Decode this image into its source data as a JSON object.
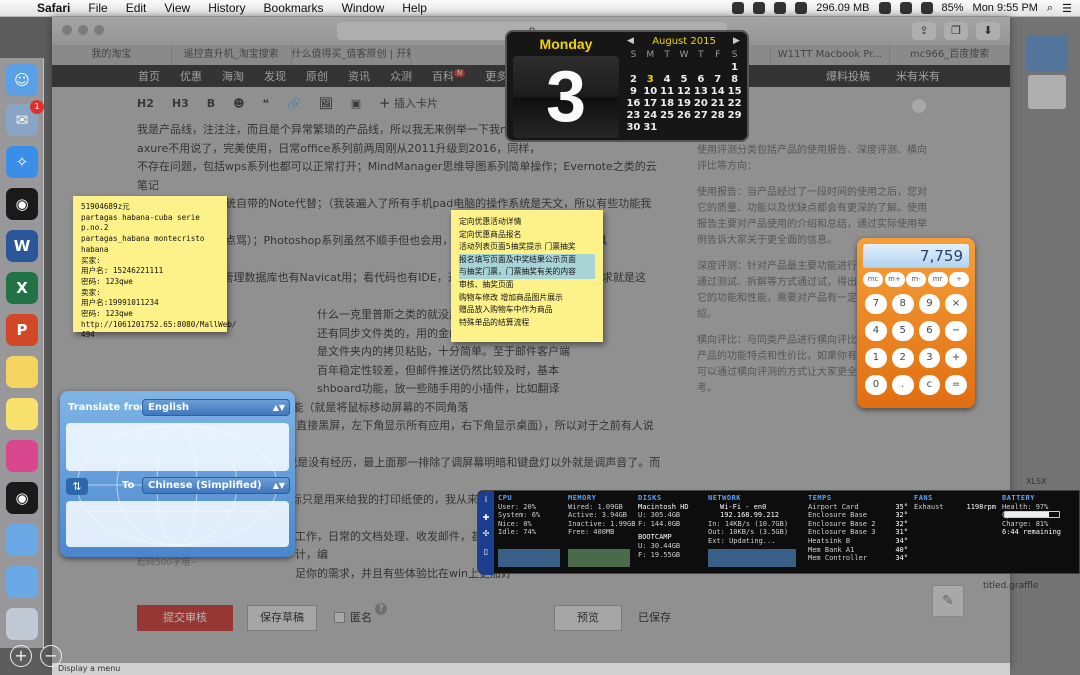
{
  "menubar": {
    "apple": "",
    "app": "Safari",
    "items": [
      "File",
      "Edit",
      "View",
      "History",
      "Bookmarks",
      "Window",
      "Help"
    ],
    "memory": "296.09 MB",
    "battery": "85%",
    "clock": "Mon 9:55 PM"
  },
  "browser": {
    "address_fragment": "p",
    "tabs": [
      "我的淘宝",
      "遥控直升机_淘宝搜索",
      "什么值得买_值客原创 | 开箱晒...",
      "",
      "",
      "",
      "W11TT Macbook Pr...",
      "mc966_百度搜索"
    ],
    "site_nav": [
      "首页",
      "优惠",
      "海淘",
      "发现",
      "原创",
      "资讯",
      "众测",
      "百科",
      "更多"
    ],
    "site_nav_badge": "N",
    "site_nav_right": [
      "爆料投稿",
      "米有米有"
    ]
  },
  "editor": {
    "tools": [
      "H2",
      "H3",
      "B",
      "☻",
      "❝",
      "🔗",
      "🖼",
      "▣",
      "插入卡片"
    ],
    "article": [
      "我是产品线，注注注，而且是个异常繁琐的产品线，所以我无来例举一下我mac",
      "axure不用说了，完美使用，日常office系列前两周刚从2011升级到2016，同样，",
      "不存在问题，包括wps系列也都可以正常打开；MindManager思维导图系列简单操作；Evernote之类的云笔记",
      "后来直接被我用系统自带的Note代替；（我装遍入了所有手机pad电脑的操作系统是天文，所以有些功能我翻译",
      "过来可能不对，轻点骂）；Photoshop系列虽然不顺手但也会用，另有一个轻量级的图片编辑工具Pixelmator代替",
      "有securesCRT；管理数据库也有Navicat用；看代码也有IDE，这个不多说。总之，工作中的需求就是这些，但我不",
      "什么一克里普斯之类的就没用过了，但是也有。",
      "还有同步文件类的，用的金山快盘，手机pad端都有",
      "是文件夹内的拷贝粘贴，十分简单。至于邮件客户端",
      "百年稳定性较差，但邮件推送仍然比较及时，基本",
      "shboard功能，放一些随手用的小插件，比如翻译",
      "情況差別，再配合HotCorner功能（就是将鼠标移动屏幕的不同角落",
      "到左上角出DashBoard，右上角直接黑屏，左下角显示所有应用，右下角显示桌面），所以对于之前有人说需要",
      "使用什么cmd+F几之类的操作我是没有经历，最上面那一排除了调屏幕明暗和键盘灯以外就是调声音了。而且我",
      "要说一点，我不用鼠标！我的鼠标只是用来给我的打印纸使的，我从来不带那货出门。",
      "",
      "工作，日常的文档处理、收发邮件，甚至作图，设计，音乐编辑，产品设计，编",
      "足你的需求，并且有些体验比在win上更加好"
    ],
    "side_info": [
      "使用评测分类包括产品的使用报告、深度评测、横向评比等方向：",
      "使用报告：当产品经过了一段时间的使用之后，您对它的质量、功能以及优缺点都会有更深的了解。使用报告主要对产品使用的介绍和总结，通过实际使用举例告诉大家关于更全面的信息。",
      "深度评测：针对产品最主要功能进行细致入微的测，通过测试、拆解等方式通过试，得出结论和分析展示它的功能和性能，需要对产品有一定详细的图文介绍。",
      "横向评比：与同类产品进行横向评比，通过对比展现产品的功能特点和性价比，如果你有相关条件，不妨可以通过横向评测的方式让大家更全面的信息和参考。"
    ],
    "hint": "起码500字哦~",
    "submit": "提交审核",
    "draft": "保存草稿",
    "anon": "匿名",
    "help": "?",
    "preview": "预览",
    "saved": "已保存"
  },
  "calendar": {
    "weekday": "Monday",
    "day": "3",
    "month": "August 2015",
    "dow": [
      "S",
      "M",
      "T",
      "W",
      "T",
      "F",
      "S"
    ],
    "days": [
      "",
      "",
      "",
      "",
      "",
      "",
      "1",
      "2",
      "3",
      "4",
      "5",
      "6",
      "7",
      "8",
      "9",
      "10",
      "11",
      "12",
      "13",
      "14",
      "15",
      "16",
      "17",
      "18",
      "19",
      "20",
      "21",
      "22",
      "23",
      "24",
      "25",
      "26",
      "27",
      "28",
      "29",
      "30",
      "31"
    ],
    "today": "3"
  },
  "note1": {
    "lines": [
      "51904689z元",
      "partagas habana-cuba serie p.no.2",
      "partagas_habana montecristo habana",
      "买家:",
      "用户名: 15246221111",
      "密码: 123qwe",
      "卖家:",
      "用户名:19991011234",
      "密码: 123qwe",
      "http://1061201752.65:8080/MallWeb/",
      "494"
    ]
  },
  "note2": {
    "lines": [
      "定向优惠活动详情",
      "定向优惠商品报名",
      "活动列表页面5抽奖提示 门票抽奖",
      "报名填写页面及中奖结果公示页面",
      "与抽奖门票，门票抽奖有关的内容",
      "审核、抽奖页面",
      "购物车修改 增加商品图片展示",
      "赠品放入购物车中作为商品",
      "特殊单品的结算流程"
    ],
    "highlight": [
      3,
      4
    ]
  },
  "calculator": {
    "display": "7,759",
    "mem": [
      "mc",
      "m+",
      "m-",
      "mr",
      "÷"
    ],
    "keys": [
      "7",
      "8",
      "9",
      "×",
      "4",
      "5",
      "6",
      "−",
      "1",
      "2",
      "3",
      "+",
      "0",
      ".",
      "c",
      "="
    ]
  },
  "translate": {
    "from_label": "Translate from",
    "from": "English",
    "to_label": "To",
    "to": "Chinese (Simplified)",
    "swap": "⇅"
  },
  "istat": {
    "cpu": {
      "title": "CPU",
      "lines": [
        "User: 20%",
        "System: 6%",
        "Nice: 0%",
        "Idle: 74%"
      ]
    },
    "memory": {
      "title": "MEMORY",
      "lines": [
        "Wired: 1.09GB",
        "Active: 3.94GB",
        "Inactive: 1.99GB",
        "Free: 400MB"
      ]
    },
    "disks": {
      "title": "DISKS",
      "lines": [
        "Macintosh HD",
        "U: 305.4GB",
        "F: 144.0GB",
        "",
        "BOOTCAMP",
        "U: 30.44GB",
        "F: 19.55GB"
      ]
    },
    "network": {
      "title": "NETWORK",
      "lines": [
        "Wi-Fi - en0",
        "192.168.99.212",
        "In: 14KB/s (10.7GB)",
        "Out: 10KB/s (3.5GB)",
        "Ext: Updating..."
      ]
    },
    "temps": {
      "title": "TEMPS",
      "labels": [
        "Airport Card",
        "Enclosure Base",
        "Enclosure Base 2",
        "Enclosure Base 3",
        "Heatsink B",
        "Mem Bank A1",
        "Mem Controller"
      ],
      "values": [
        "35°",
        "32°",
        "32°",
        "31°",
        "34°",
        "40°",
        "34°"
      ]
    },
    "fans": {
      "title": "FANS",
      "label": "Exhaust",
      "value": "1198rpm"
    },
    "battery": {
      "title": "BATTERY",
      "lines": [
        "Health: 97%",
        "Cycles: 260",
        "Charge: 81%",
        "6:44 remaining"
      ],
      "charge": 0.81
    }
  },
  "desktop": {
    "xlsx": "XLSX",
    "graffle": "titled.graffle"
  },
  "status": "Display a menu",
  "dock": {
    "badge": "1",
    "items": [
      "finder-icon",
      "mail-icon",
      "safari-icon",
      "qq-icon",
      "word-icon",
      "excel-icon",
      "powerpoint-icon",
      "notes-icon",
      "stickies-icon",
      "photo-icon",
      "qq-icon",
      "folder-icon",
      "folder-icon",
      "folder-icon",
      "trash-icon"
    ]
  }
}
